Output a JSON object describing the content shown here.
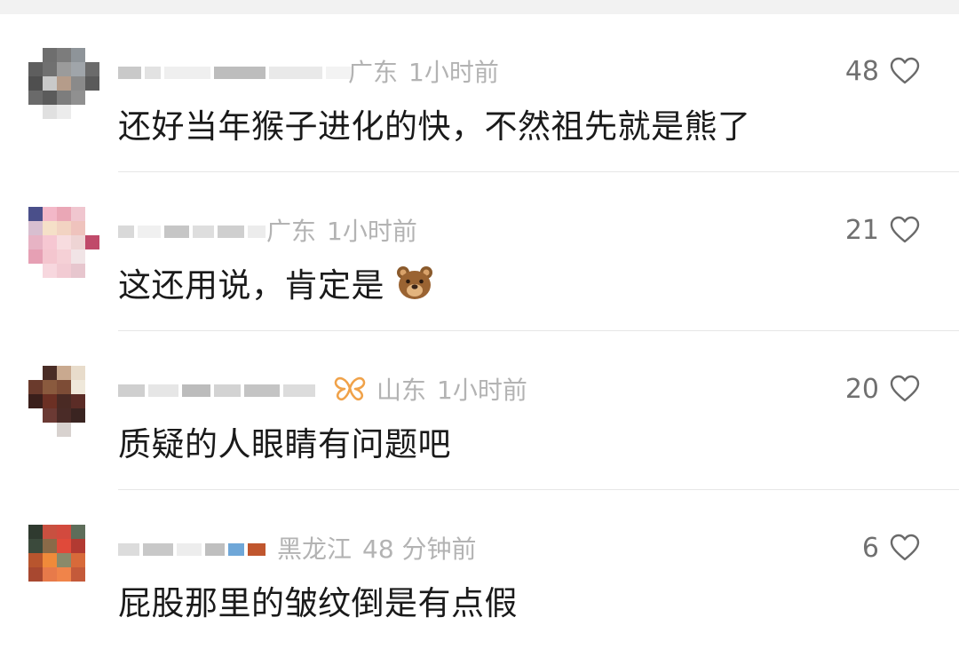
{
  "comments": [
    {
      "location": "广东",
      "time": "1小时前",
      "likes": "48",
      "text": "还好当年猴子进化的快，不然祖先就是熊了",
      "avatar_colors": [
        "#ffffff",
        "#6e6e6e",
        "#7c7c7c",
        "#8e9499",
        "#ffffff",
        "#5e5e5e",
        "#707070",
        "#9b9b9b",
        "#a0a5aa",
        "#6b6b6b",
        "#4f4f4f",
        "#c9c9c9",
        "#b59c8a",
        "#8a8a8a",
        "#5a5a5a",
        "#6a6a6a",
        "#5b5b5b",
        "#7d7d7d",
        "#909090",
        "#ffffff",
        "#ffffff",
        "#e0e0e0",
        "#ececec",
        "#ffffff",
        "#ffffff"
      ]
    },
    {
      "location": "广东",
      "time": "1小时前",
      "likes": "21",
      "text": "这还用说，肯定是",
      "emoji": "bear-face-emoji",
      "avatar_colors": [
        "#4a4f8a",
        "#f3b8c8",
        "#eaa7b6",
        "#f0c6cf",
        "#ffffff",
        "#d8bfd0",
        "#f5e0c8",
        "#f2d3c2",
        "#efc3bd",
        "#ffffff",
        "#e7b3c4",
        "#f6c7d2",
        "#f7dcdf",
        "#eed4d4",
        "#c04a6a",
        "#e6a0b4",
        "#f4c6cf",
        "#f5d0d6",
        "#f1e4e6",
        "#ffffff",
        "#ffffff",
        "#f7d7de",
        "#f2cbd3",
        "#e7c6ce",
        "#ffffff"
      ]
    },
    {
      "location": "山东",
      "time": "1小时前",
      "likes": "20",
      "text": "质疑的人眼睛有问题吧",
      "badge": "butterfly-badge-icon",
      "badge_color": "#f0a24a",
      "avatar_colors": [
        "#ffffff",
        "#4a2d26",
        "#c9a98f",
        "#e8dccb",
        "#ffffff",
        "#6a3a2c",
        "#8a5a3e",
        "#7d4c36",
        "#efe8da",
        "#ffffff",
        "#3a1f1b",
        "#6c3024",
        "#4a2a24",
        "#5b2c26",
        "#ffffff",
        "#ffffff",
        "#6b3a34",
        "#4a2b27",
        "#3a2421",
        "#ffffff",
        "#ffffff",
        "#ffffff",
        "#d8d2cf",
        "#ffffff",
        "#ffffff"
      ]
    },
    {
      "location": "黑龙江",
      "time": "48 分钟前",
      "likes": "6",
      "text": "屁股那里的皱纹倒是有点假",
      "avatar_colors": [
        "#2f3a2f",
        "#c85040",
        "#d24a3e",
        "#5e6d5a",
        "#ffffff",
        "#3b4a3c",
        "#8a6a48",
        "#e04a3a",
        "#b23a32",
        "#ffffff",
        "#b8552e",
        "#f08a3a",
        "#8a8a6a",
        "#d86a3a",
        "#ffffff",
        "#a84830",
        "#e77a4a",
        "#f0844a",
        "#c45a3a",
        "#ffffff",
        "#ffffff",
        "#ffffff",
        "#ffffff",
        "#ffffff",
        "#ffffff"
      ]
    }
  ]
}
